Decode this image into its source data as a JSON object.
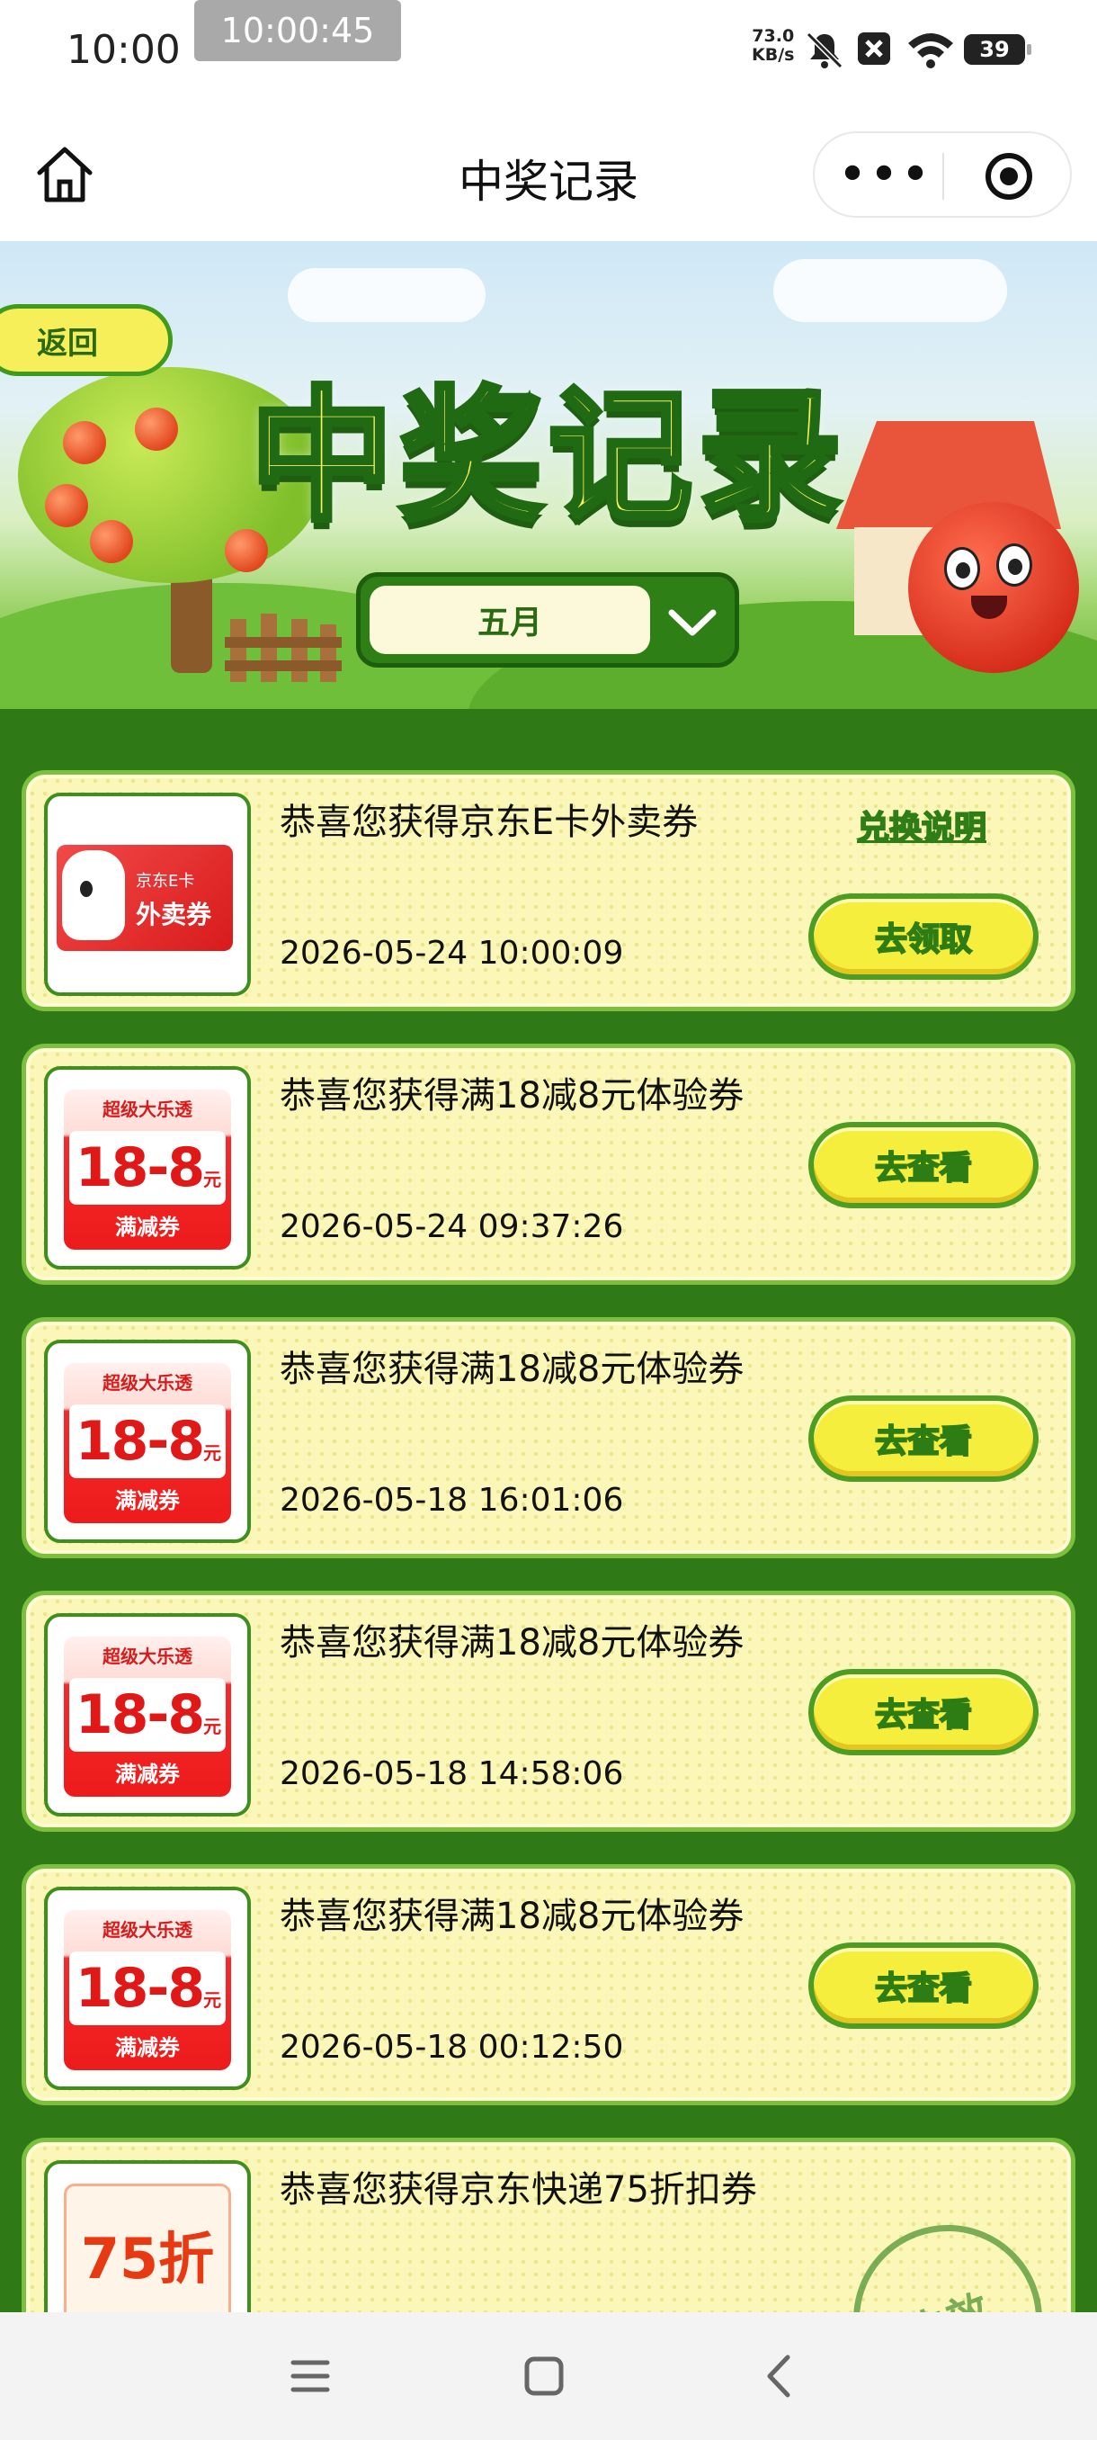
{
  "status_bar": {
    "time": "10:00",
    "clock_overlay": "10:00:45",
    "net_speed_value": "73.0",
    "net_speed_unit": "KB/s",
    "battery": "39"
  },
  "title_bar": {
    "title": "中奖记录",
    "more_icon": "more-dots-icon",
    "close_icon": "record-target-icon"
  },
  "banner": {
    "back_label": "返回",
    "big_title": "中奖记录",
    "month_selected": "五月"
  },
  "records": [
    {
      "message": "恭喜您获得京东E卡外卖券",
      "time": "2026-05-24 10:00:09",
      "action": "去领取",
      "extra_link": "兑换说明",
      "thumb": "ecard",
      "thumb_t1": "京东E卡",
      "thumb_t2": "外卖券"
    },
    {
      "message": "恭喜您获得满18减8元体验券",
      "time": "2026-05-24 09:37:26",
      "action": "去查看",
      "thumb": "coupon",
      "thumb_top": "超级大乐透",
      "thumb_value": "18-8",
      "thumb_unit": "元",
      "thumb_bottom": "满减券"
    },
    {
      "message": "恭喜您获得满18减8元体验券",
      "time": "2026-05-18 16:01:06",
      "action": "去查看",
      "thumb": "coupon",
      "thumb_top": "超级大乐透",
      "thumb_value": "18-8",
      "thumb_unit": "元",
      "thumb_bottom": "满减券"
    },
    {
      "message": "恭喜您获得满18减8元体验券",
      "time": "2026-05-18 14:58:06",
      "action": "去查看",
      "thumb": "coupon",
      "thumb_top": "超级大乐透",
      "thumb_value": "18-8",
      "thumb_unit": "元",
      "thumb_bottom": "满减券"
    },
    {
      "message": "恭喜您获得满18减8元体验券",
      "time": "2026-05-18 00:12:50",
      "action": "去查看",
      "thumb": "coupon",
      "thumb_top": "超级大乐透",
      "thumb_value": "18-8",
      "thumb_unit": "元",
      "thumb_bottom": "满减券"
    },
    {
      "message": "恭喜您获得京东快递75折扣券",
      "time": "",
      "action": "",
      "thumb": "discount",
      "thumb_value": "75折",
      "stamp": "失效"
    }
  ],
  "colors": {
    "background_green": "#2f7a16",
    "card_fill": "#fbf7b8",
    "button_yellow": "#f6ee3d",
    "coupon_red": "#ed1b1b"
  }
}
